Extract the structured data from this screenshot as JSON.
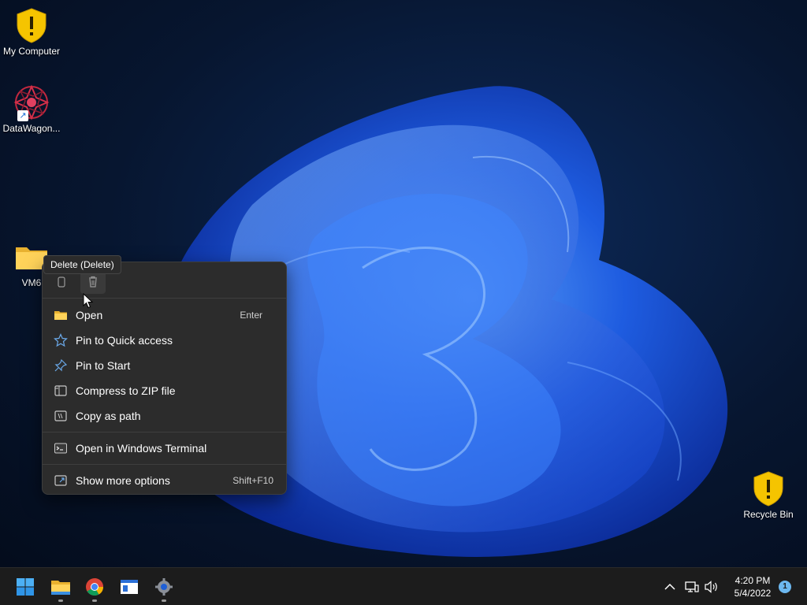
{
  "desktop": {
    "icons": [
      {
        "label": "My Computer",
        "icon": "shield-warning-icon"
      },
      {
        "label": "DataWagon...",
        "icon": "datawagon-app-icon"
      },
      {
        "label": "VM6",
        "icon": "folder-icon"
      },
      {
        "label": "Recycle Bin",
        "icon": "shield-warning-icon"
      }
    ]
  },
  "tooltip": {
    "text": "Delete (Delete)"
  },
  "context_menu": {
    "top_actions": [
      {
        "name": "copy",
        "icon": "copy-icon"
      },
      {
        "name": "delete",
        "icon": "trash-icon"
      }
    ],
    "items": [
      {
        "label": "Open",
        "shortcut": "Enter",
        "icon": "folder-open-icon"
      },
      {
        "label": "Pin to Quick access",
        "shortcut": "",
        "icon": "star-icon"
      },
      {
        "label": "Pin to Start",
        "shortcut": "",
        "icon": "pin-icon"
      },
      {
        "label": "Compress to ZIP file",
        "shortcut": "",
        "icon": "zip-icon"
      },
      {
        "label": "Copy as path",
        "shortcut": "",
        "icon": "copy-path-icon"
      },
      {
        "label": "Open in Windows Terminal",
        "shortcut": "",
        "icon": "terminal-icon"
      },
      {
        "label": "Show more options",
        "shortcut": "Shift+F10",
        "icon": "more-options-icon"
      }
    ]
  },
  "taskbar": {
    "apps": [
      "start-icon",
      "file-explorer-icon",
      "chrome-icon",
      "window-app-icon",
      "settings-icon"
    ],
    "clock": {
      "time": "4:20 PM",
      "date": "5/4/2022"
    },
    "notification_count": "1"
  },
  "colors": {
    "menu_bg": "#2c2c2c",
    "taskbar_bg": "#1c1c1c",
    "accent": "#1a6fd6",
    "shield_yellow": "#f5c400"
  }
}
